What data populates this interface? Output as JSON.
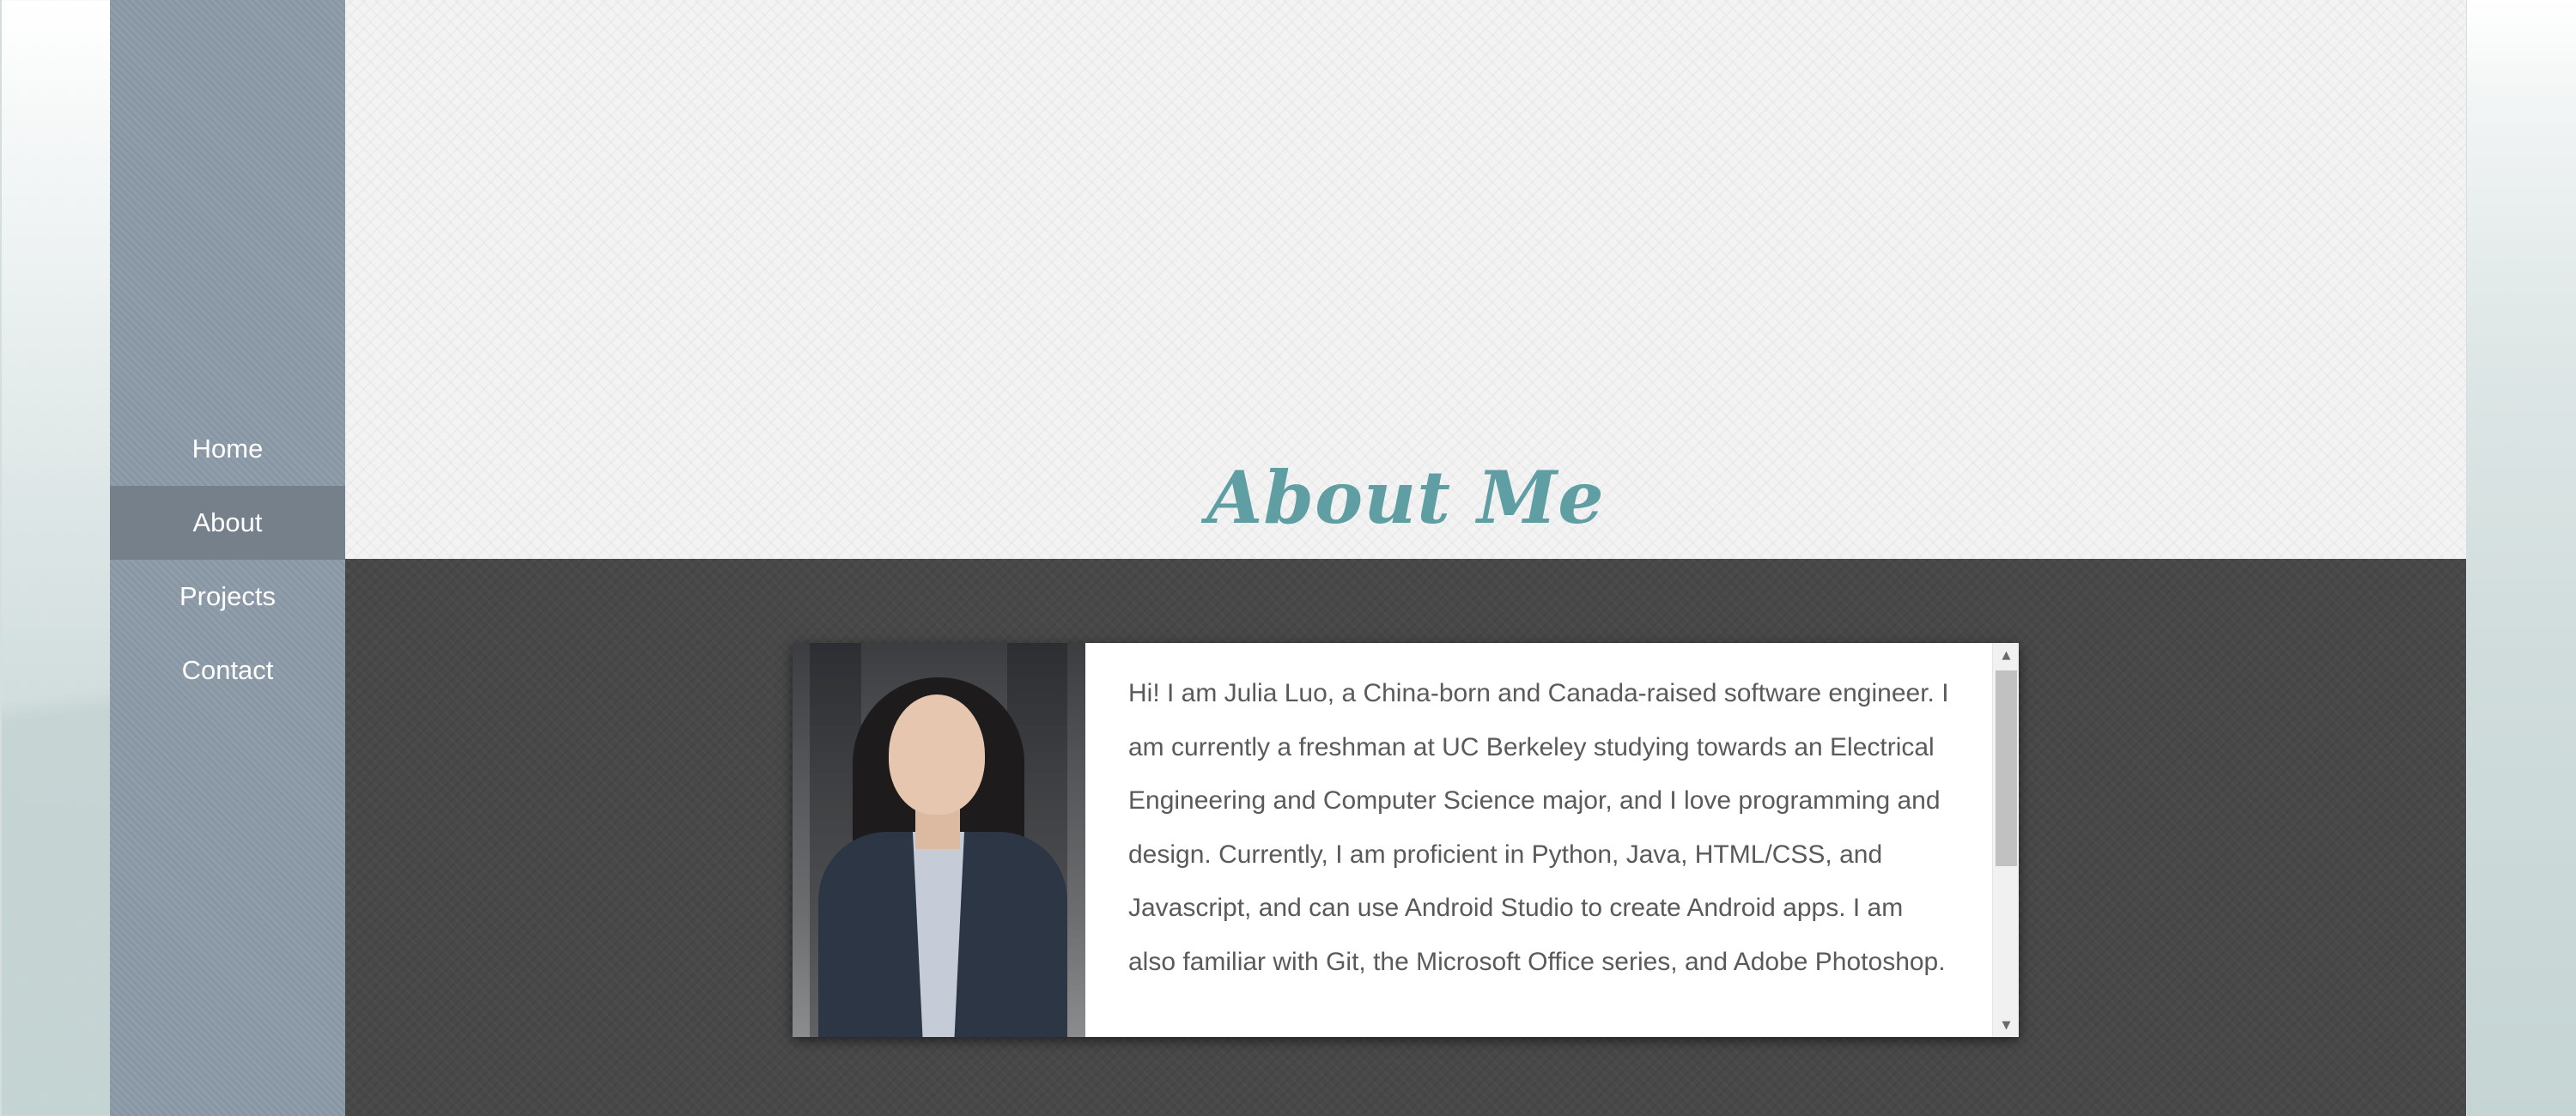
{
  "nav": {
    "items": [
      {
        "label": "Home",
        "active": false
      },
      {
        "label": "About",
        "active": true
      },
      {
        "label": "Projects",
        "active": false
      },
      {
        "label": "Contact",
        "active": false
      }
    ]
  },
  "header": {
    "title": "About Me"
  },
  "about": {
    "photo_alt": "Portrait of Julia Luo",
    "bio": "Hi! I am Julia Luo, a China-born and Canada-raised software engineer. I am currently a freshman at UC Berkeley studying towards an Electrical Engineering and Computer Science major, and I love programming and design. Currently, I am proficient in Python, Java, HTML/CSS, and Javascript, and can use Android Studio to create Android apps. I am also familiar with Git, the Microsoft Office series, and Adobe Photoshop."
  },
  "scrollbar": {
    "up_icon": "triangle-up",
    "down_icon": "triangle-down"
  },
  "colors": {
    "sidebar": "#8c9aa8",
    "sidebar_active": "#75808b",
    "title_accent": "#5f9fa3",
    "content_bg": "#484848"
  }
}
